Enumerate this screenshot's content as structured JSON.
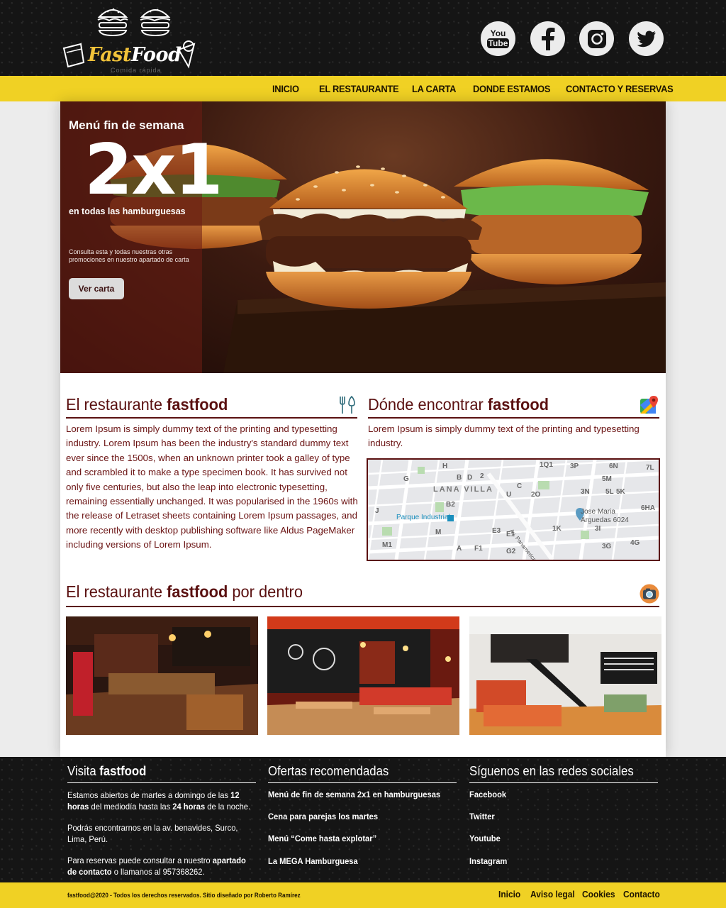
{
  "brand": {
    "logo_first": "Fast",
    "logo_second": "Food",
    "logo_sub": "Comida rápida"
  },
  "social_top": [
    {
      "name": "youtube",
      "icon": "youtube-icon",
      "label_top": "You",
      "label_bottom": "Tube"
    },
    {
      "name": "facebook",
      "icon": "facebook-icon"
    },
    {
      "name": "instagram",
      "icon": "instagram-icon"
    },
    {
      "name": "twitter",
      "icon": "twitter-icon"
    }
  ],
  "nav": [
    "INICIO",
    "EL RESTAURANTE",
    "LA CARTA",
    "DONDE ESTAMOS",
    "CONTACTO Y RESERVAS"
  ],
  "hero": {
    "title": "Menú fin de semana",
    "big": "2x1",
    "subtitle": "en todas las hamburguesas",
    "note": "Consulta esta y todas nuestras otras promociones en nuestro apartado de carta",
    "button": "Ver carta"
  },
  "restaurant": {
    "heading_light": "El restaurante ",
    "heading_bold": "fastfood",
    "icon": "cutlery-icon",
    "text": "Lorem Ipsum is simply dummy text of the printing and typesetting industry. Lorem Ipsum has been the industry's standard dummy text ever since the 1500s, when an unknown printer took a galley of type and scrambled it to make a type specimen book. It has survived not only five centuries, but also the leap into electronic typesetting, remaining essentially unchanged. It was popularised in the 1960s with the release of Letraset sheets containing Lorem Ipsum passages, and more recently with desktop publishing software like Aldus PageMaker including versions of Lorem Ipsum."
  },
  "location": {
    "heading_light": "Dónde encontrar ",
    "heading_bold": "fastfood",
    "icon": "google-maps-icon",
    "text": "Lorem Ipsum is simply dummy text of the printing and typesetting industry.",
    "map": {
      "district": "LANA VILLA",
      "station": "Parque Industrial",
      "place": "Jose Maria Arguedas 6024",
      "street": "Av. Panamericana"
    }
  },
  "gallery": {
    "heading_light": "El restaurante ",
    "heading_bold": "fastfood",
    "heading_tail": " por dentro",
    "icon": "camera-icon"
  },
  "footer": {
    "visit": {
      "heading_light": "Visita ",
      "heading_bold": "fastfood",
      "p1_a": "Estamos abiertos de martes a domingo de las ",
      "p1_b": "12 horas",
      "p1_c": " del mediodía hasta las ",
      "p1_d": "24 horas",
      "p1_e": " de la noche.",
      "p2": "Podrás encontrarnos en la av. benavides, Surco, Lima, Perú.",
      "p3_a": "Para reservas puede consultar a nuestro ",
      "p3_b": "apartado de contacto",
      "p3_c": " o llamanos al 957368262."
    },
    "offers": {
      "heading": "Ofertas recomendadas",
      "items": [
        "Menú de fin de semana 2x1 en hamburguesas",
        "Cena para parejas los martes",
        "Menú “Come hasta explotar”",
        "La MEGA Hamburguesa"
      ]
    },
    "social": {
      "heading": "Síguenos en las redes sociales",
      "items": [
        "Facebook",
        "Twitter",
        "Youtube",
        "Instagram"
      ]
    }
  },
  "bottom": {
    "copyright": "fastfood@2020 - Todos los derechos reservados. Sitio diseñado por Roberto Ramírez",
    "links": [
      "Inicio",
      "Aviso legal",
      "Cookies",
      "Contacto"
    ]
  },
  "colors": {
    "accent": "#f0d124",
    "dark": "#151515",
    "maroon": "#5a1010"
  }
}
